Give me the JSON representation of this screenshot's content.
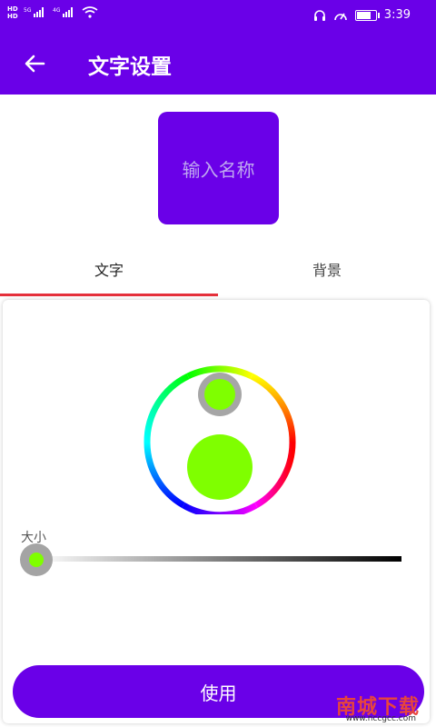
{
  "status_bar": {
    "hd1": "HD",
    "hd2": "HD",
    "sig1": "5G",
    "sig2": "4G",
    "time": "3:39",
    "icons": [
      "headset-icon",
      "speed-icon",
      "battery-icon",
      "wifi-icon",
      "signal-icon"
    ]
  },
  "app_bar": {
    "title": "文字设置",
    "back_icon": "arrow-left-icon"
  },
  "preview": {
    "placeholder": "输入名称",
    "background": "#6a00e8"
  },
  "tabs": [
    {
      "label": "文字",
      "selected": true
    },
    {
      "label": "背景",
      "selected": false
    }
  ],
  "color_picker": {
    "selected_color": "#7fff00",
    "hue_ring": [
      "#ff0000",
      "#ffff00",
      "#00ff00",
      "#00ffff",
      "#0000ff",
      "#ff00ff",
      "#ff0000"
    ]
  },
  "size_slider": {
    "label": "大小",
    "value": 0,
    "gradient_start": "#ffffff",
    "gradient_end": "#000000"
  },
  "use_button": {
    "label": "使用"
  },
  "watermark": {
    "text": "南城下载",
    "url": "www.nccgcc.com"
  },
  "colors": {
    "primary": "#6a00e8",
    "tab_indicator": "#e5303b"
  }
}
